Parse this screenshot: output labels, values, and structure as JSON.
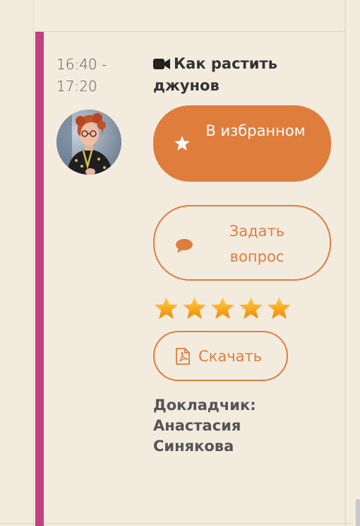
{
  "session": {
    "time": "16:40 - 17:20",
    "title": "Как растить джунов",
    "favorite_button": "В избранном",
    "ask_button": "Задать вопрос",
    "download_button": "Скачать",
    "rating": 5,
    "speaker_label": "Докладчик:",
    "speaker_name": "Анастасия Синякова"
  },
  "icons": {
    "title": "video-camera-icon",
    "favorite": "star-icon",
    "ask": "speech-bubble-icon",
    "download": "pdf-file-icon"
  },
  "colors": {
    "accent": "#df7d3d",
    "track_bar": "#c2407f",
    "background": "#f4ebdf",
    "star": "#f3a415"
  }
}
